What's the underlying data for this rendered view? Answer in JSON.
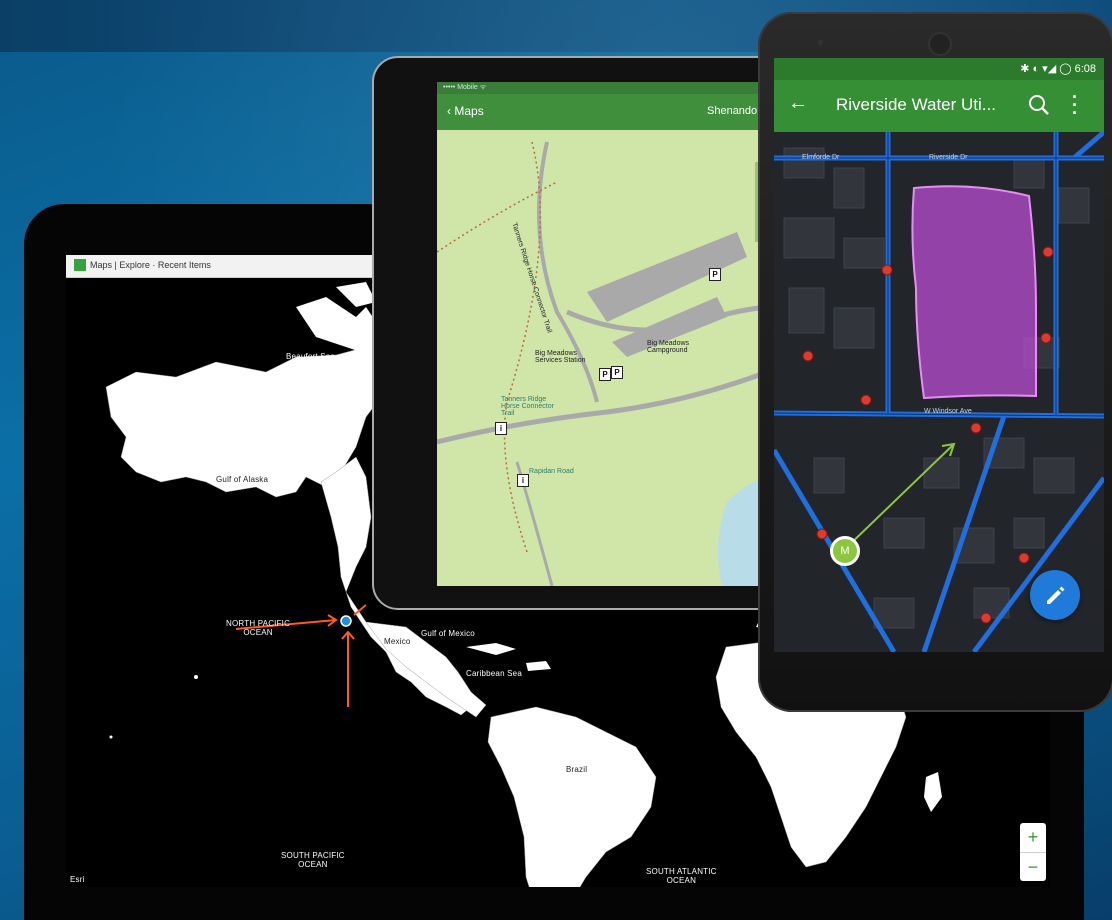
{
  "colors": {
    "background": "#0b6fa6",
    "app_green": "#358f34",
    "red_pin": "#e03a2f",
    "fab_blue": "#1f7ad9",
    "selection_purple": "#b04bc8",
    "measure_green": "#8cc63f",
    "annotation_orange": "#ff5a1f"
  },
  "web_map_tablet": {
    "app_icon": "app-grid-icon",
    "breadcrumb": "Maps  |  Explore  ·  Recent Items",
    "labels": {
      "beaufort_sea": "Beaufort Sea",
      "gulf_of_alaska": "Gulf of Alaska",
      "north_pacific": "NORTH PACIFIC\nOCEAN",
      "mexico": "Mexico",
      "gulf_of_mexico": "Gulf of Mexico",
      "caribbean_sea": "Caribbean Sea",
      "brazil": "Brazil",
      "south_pacific": "SOUTH PACIFIC\nOCEAN",
      "south_atlantic": "SOUTH ATLANTIC\nOCEAN",
      "esri": "Esri"
    },
    "zoom_in": "+",
    "zoom_out": "−"
  },
  "topo_tablet": {
    "status_text": "••••• Mobile ᯤ",
    "back_label": "Maps",
    "title": "Shenando",
    "labels": {
      "trail": "Tanners Ridge Horse Connector Trail",
      "services": "Big Meadows\nServices Station",
      "campground": "Big Meadows\nCampground",
      "cemetery": "Tanners Ridge\nHorse Connector\nTrail",
      "road": "Rapidan Road"
    },
    "poi_symbols": [
      "P",
      "P",
      "P",
      "i",
      "i"
    ]
  },
  "phone": {
    "status_time": "✱ ◐ ▾◢ ◯ 6:08",
    "back_icon": "arrow-left-icon",
    "title": "Riverside Water Uti...",
    "search_icon": "search-icon",
    "more_icon": "more-vertical-icon",
    "streets": {
      "s1": "Elmforde Dr",
      "s2": "Riverside Dr",
      "s3": "W Windsor Ave"
    },
    "marker_label": "M",
    "fab_icon": "edit-pencil-icon"
  }
}
